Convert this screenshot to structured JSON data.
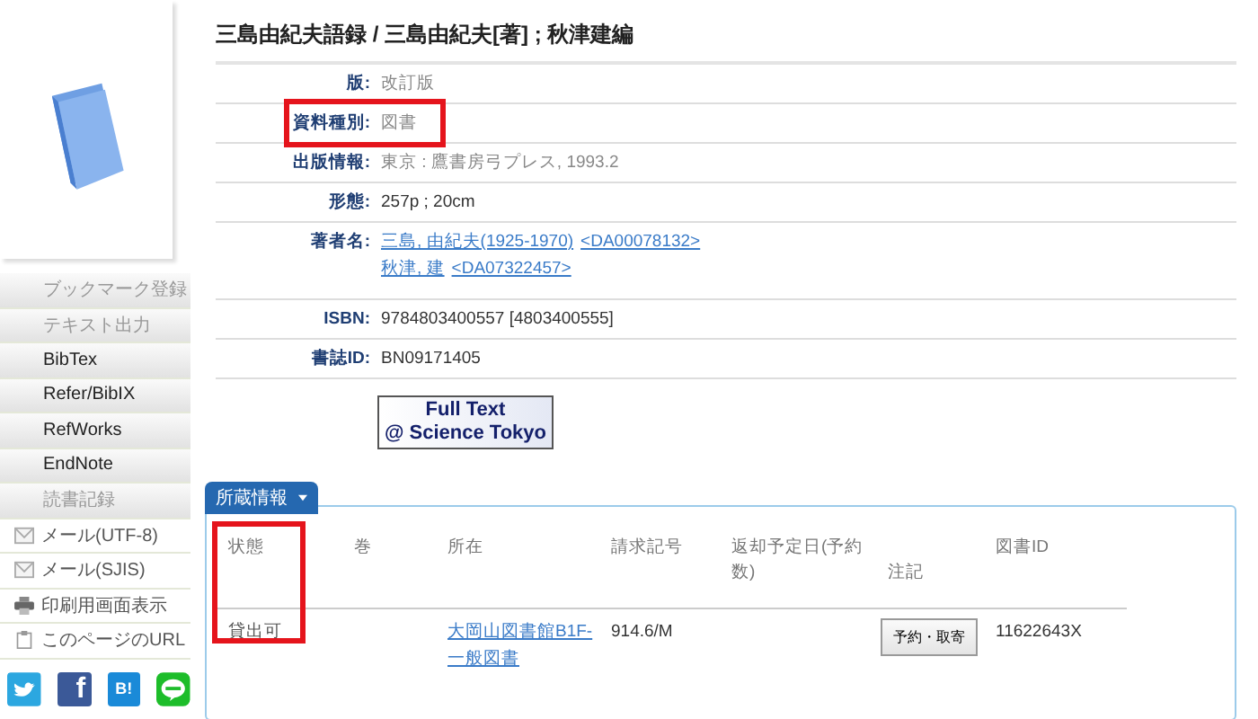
{
  "sidebar": {
    "items": [
      {
        "label": "ブックマーク登録",
        "kind": "button",
        "disabled": true
      },
      {
        "label": "テキスト出力",
        "kind": "button",
        "disabled": true
      },
      {
        "label": "BibTex",
        "kind": "button",
        "disabled": false
      },
      {
        "label": "Refer/BibIX",
        "kind": "button",
        "disabled": false
      },
      {
        "label": "RefWorks",
        "kind": "button",
        "disabled": false
      },
      {
        "label": "EndNote",
        "kind": "button",
        "disabled": false
      },
      {
        "label": "読書記録",
        "kind": "button",
        "disabled": true
      },
      {
        "label": "メール(UTF-8)",
        "kind": "mail",
        "disabled": false
      },
      {
        "label": "メール(SJIS)",
        "kind": "mail",
        "disabled": false
      },
      {
        "label": "印刷用画面表示",
        "kind": "print",
        "disabled": false
      },
      {
        "label": "このページのURL",
        "kind": "page",
        "disabled": false
      }
    ],
    "share": [
      {
        "kind": "twitter"
      },
      {
        "kind": "facebook",
        "label": "f"
      },
      {
        "kind": "hatena",
        "label": "B!"
      },
      {
        "kind": "line"
      }
    ]
  },
  "title": "三島由紀夫語録 / 三島由紀夫[著] ; 秋津建編",
  "fields": [
    {
      "label": "版:",
      "value": "改訂版",
      "highlighted": false
    },
    {
      "label": "資料種別:",
      "value": "図書",
      "highlighted": true
    },
    {
      "label": "出版情報:",
      "value": "東京 : 鷹書房弓プレス, 1993.2",
      "highlighted": false
    },
    {
      "label": "形態:",
      "value": "257p ; 20cm",
      "highlighted": false
    },
    {
      "label": "著者名:",
      "links": [
        [
          "三島, 由紀夫(1925-1970)",
          "<DA00078132>"
        ],
        [
          "秋津, 建",
          "<DA07322457>"
        ]
      ],
      "highlighted": false
    },
    {
      "label": "ISBN:",
      "value": "9784803400557 [4803400555]",
      "highlighted": false
    },
    {
      "label": "書誌ID:",
      "value": "BN09171405",
      "highlighted": false
    }
  ],
  "full_text": {
    "line1": "Full Text",
    "line2": "@ Science Tokyo"
  },
  "holdings": {
    "tab": "所蔵情報",
    "columns": [
      {
        "label": "状態",
        "highlighted": true
      },
      {
        "label": "巻",
        "highlighted": false
      },
      {
        "label": "所在",
        "highlighted": false
      },
      {
        "label": "請求記号",
        "highlighted": false
      },
      {
        "label": "返却予定日(予約数)",
        "highlighted": false
      },
      {
        "label": "注記",
        "highlighted": false
      },
      {
        "label": "図書ID",
        "highlighted": false
      }
    ],
    "rows": [
      {
        "status": "貸出可",
        "location": "大岡山図書館B1F-一般図書",
        "call_number": "914.6/M",
        "button": "予約・取寄",
        "id": "11622643X"
      }
    ]
  }
}
